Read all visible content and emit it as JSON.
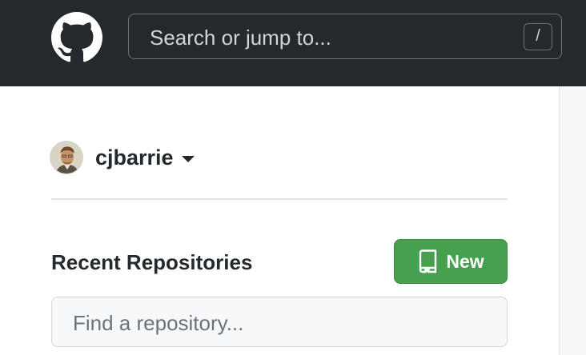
{
  "header": {
    "logo_icon": "github-octocat-icon",
    "search": {
      "placeholder": "Search or jump to...",
      "shortcut_key": "/"
    }
  },
  "user": {
    "username": "cjbarrie",
    "avatar_icon": "user-avatar"
  },
  "recent_repos": {
    "title": "Recent Repositories",
    "new_button_label": "New",
    "new_button_icon": "repo-book-icon",
    "filter_placeholder": "Find a repository..."
  },
  "colors": {
    "header_bg": "#24292e",
    "new_button_bg": "#46a04f",
    "text": "#24292e"
  }
}
